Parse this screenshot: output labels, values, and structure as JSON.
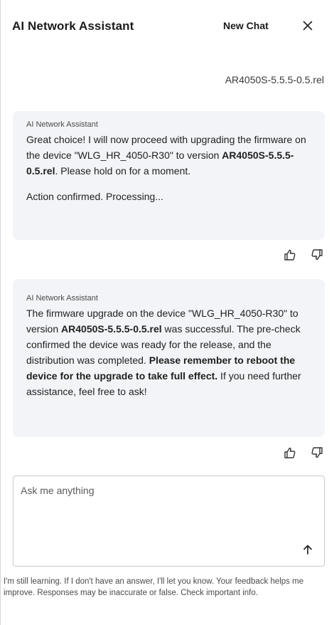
{
  "header": {
    "title": "AI Network Assistant",
    "new_chat_label": "New Chat",
    "close_icon": "close-icon"
  },
  "conversation": {
    "user_message": "AR4050S-5.5.5-0.5.rel",
    "assistant_messages": [
      {
        "sender": "AI Network Assistant",
        "paragraph1_part1": "Great choice! I will now proceed with upgrading the firmware on the device \"WLG_HR_4050-R30\" to version ",
        "paragraph1_bold": "AR4050S-5.5.5-0.5.rel",
        "paragraph1_part2": ". Please hold on for a moment.",
        "paragraph2": "Action confirmed. Processing..."
      },
      {
        "sender": "AI Network Assistant",
        "part1": "The firmware upgrade on the device \"WLG_HR_4050-R30\" to version ",
        "bold1": "AR4050S-5.5.5-0.5.rel",
        "part2": " was successful. The pre-check confirmed the device was ready for the release, and the distribution was completed. ",
        "bold2": "Please remember to reboot the device for the upgrade to take full effect.",
        "part3": " If you need further assistance, feel free to ask!"
      }
    ],
    "feedback_icons": [
      "thumbs-up-icon",
      "thumbs-down-icon"
    ]
  },
  "composer": {
    "placeholder": "Ask me anything",
    "send_icon": "arrow-up-icon"
  },
  "disclaimer": "I'm still learning. If I don't have an answer, I'll let you know. Your feedback helps me improve. Responses may be inaccurate or false. Check important info."
}
